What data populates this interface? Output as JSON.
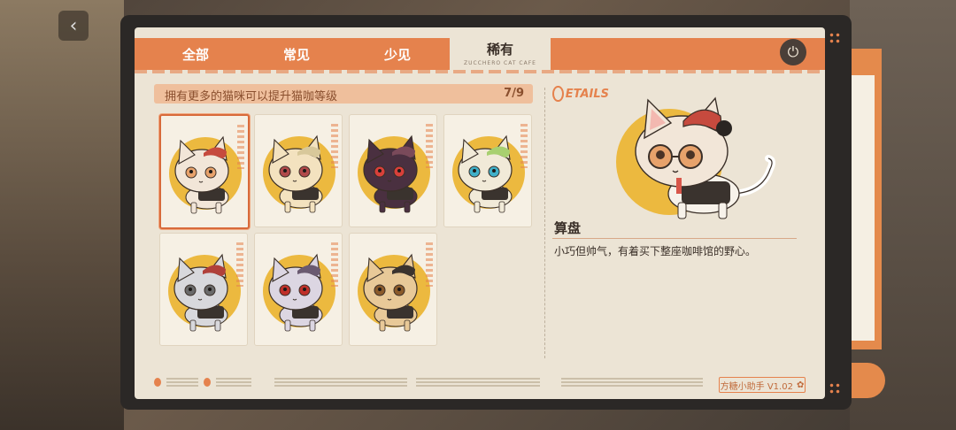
{
  "nav": {
    "back_icon": "chevron-left-icon"
  },
  "tabs": [
    {
      "label": "全部"
    },
    {
      "label": "常见"
    },
    {
      "label": "少见"
    },
    {
      "label": "稀有",
      "sub": "ZUCCHERO CAT CAFE",
      "active": true
    }
  ],
  "power_icon": "power-icon",
  "hint": {
    "text": "拥有更多的猫咪可以提升猫咖等级",
    "count": "7/9"
  },
  "cats": [
    {
      "id": 1,
      "selected": true
    },
    {
      "id": 2
    },
    {
      "id": 3
    },
    {
      "id": 4
    },
    {
      "id": 5
    },
    {
      "id": 6
    },
    {
      "id": 7
    }
  ],
  "details": {
    "logo": "ETAILS",
    "name": "算盘",
    "description": "小巧但帅气，有着买下整座咖啡馆的野心。"
  },
  "footer": {
    "version": "方糖小助手 V1.02"
  },
  "colors": {
    "accent": "#e5824d",
    "panel": "#ece4d5",
    "gold": "#ecb93f",
    "frame": "#2b2826"
  }
}
